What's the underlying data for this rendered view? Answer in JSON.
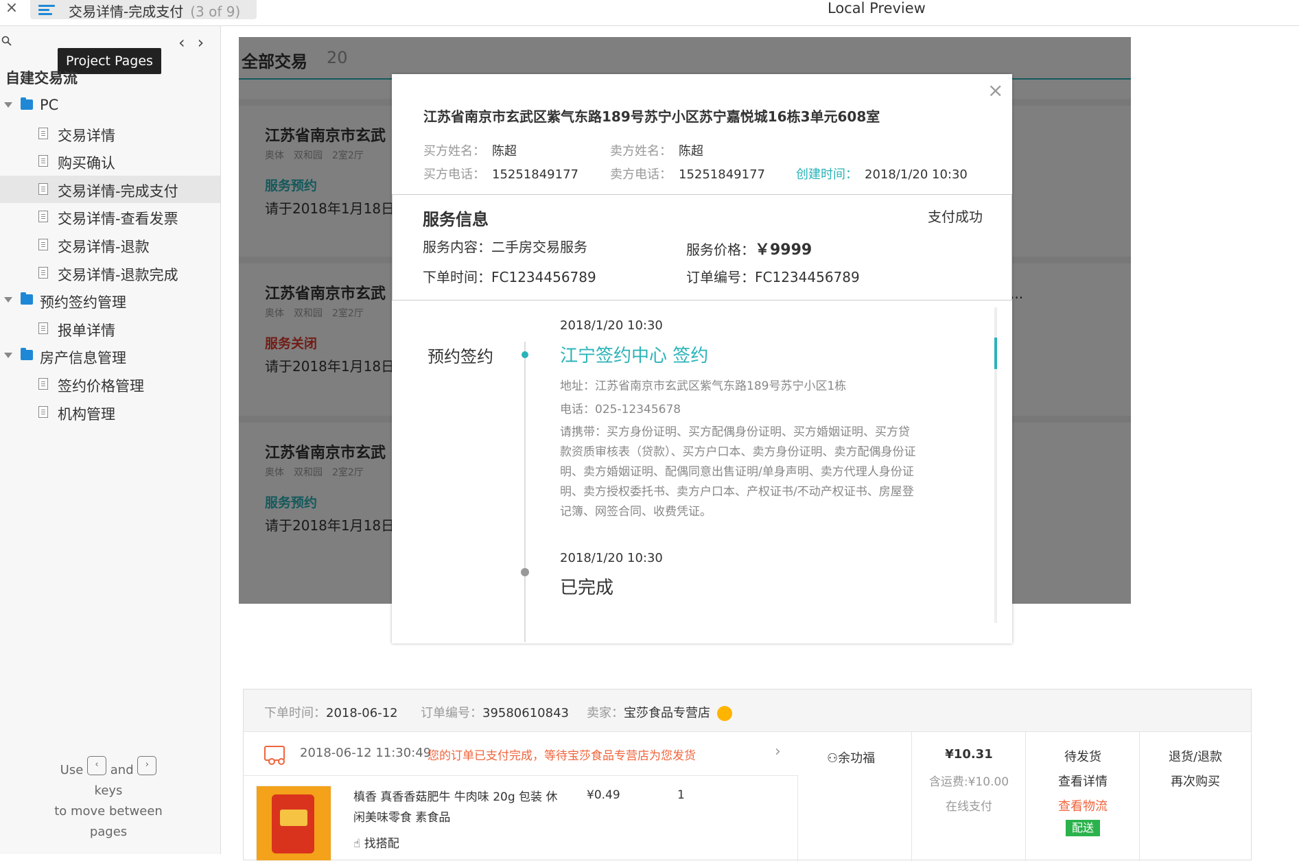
{
  "window": {
    "close_glyph": "×",
    "tab_title": "交易详情-完成支付",
    "tab_count": "(3 of 9)",
    "local_preview": "Local Preview"
  },
  "sidebar": {
    "tooltip": "Project Pages",
    "prev_glyph": "‹",
    "next_glyph": "›",
    "header": "自建交易流",
    "items": [
      {
        "label": "PC",
        "type": "folder",
        "level": 0
      },
      {
        "label": "交易详情",
        "type": "page",
        "level": 1
      },
      {
        "label": "购买确认",
        "type": "page",
        "level": 1
      },
      {
        "label": "交易详情-完成支付",
        "type": "page",
        "level": 1,
        "selected": true
      },
      {
        "label": "交易详情-查看发票",
        "type": "page",
        "level": 1
      },
      {
        "label": "交易详情-退款",
        "type": "page",
        "level": 1
      },
      {
        "label": "交易详情-退款完成",
        "type": "page",
        "level": 1
      },
      {
        "label": "预约签约管理",
        "type": "folder",
        "level": 0
      },
      {
        "label": "报单详情",
        "type": "page",
        "level": 1
      },
      {
        "label": "房产信息管理",
        "type": "folder",
        "level": 0
      },
      {
        "label": "签约价格管理",
        "type": "page",
        "level": 1
      },
      {
        "label": "机构管理",
        "type": "page",
        "level": 1
      }
    ],
    "help": {
      "use": "Use",
      "key_prev": "‹",
      "and": "and",
      "key_next": "›",
      "keys": "keys",
      "rest": "to move between",
      "pages": "pages"
    }
  },
  "list": {
    "title": "全部交易",
    "count": "20",
    "ellipsis": "...",
    "cards": [
      {
        "address": "江苏省南京市玄武",
        "sub1": "奥体",
        "sub2": "双和园",
        "sub3": "2室2厅",
        "status": "服务预约",
        "status_color": "#2ab3b8",
        "appt": "请于2018年1月18日"
      },
      {
        "address": "江苏省南京市玄武",
        "sub1": "奥体",
        "sub2": "双和园",
        "sub3": "2室2厅",
        "status": "服务关闭",
        "status_color": "#e23b2e",
        "appt": "请于2018年1月18日"
      },
      {
        "address": "江苏省南京市玄武",
        "sub1": "奥体",
        "sub2": "双和园",
        "sub3": "2室2厅",
        "status": "服务预约",
        "status_color": "#2ab3b8",
        "appt": "请于2018年1月18日"
      }
    ]
  },
  "modal": {
    "close": "×",
    "address": "江苏省南京市玄武区紫气东路189号苏宁小区苏宁嘉悦城16栋3单元608室",
    "buyer_name_label": "买方姓名：",
    "buyer_name": "陈超",
    "seller_name_label": "卖方姓名：",
    "seller_name": "陈超",
    "buyer_phone_label": "买方电话：",
    "buyer_phone": "15251849177",
    "seller_phone_label": "卖方电话：",
    "seller_phone": "15251849177",
    "created_label": "创建时间：",
    "created": "2018/1/20  10:30",
    "service": {
      "title": "服务信息",
      "status": "支付成功",
      "content_label": "服务内容：",
      "content": "二手房交易服务",
      "price_label": "服务价格：",
      "price": "￥9999",
      "order_time_label": "下单时间：",
      "order_time": "FC1234456789",
      "order_no_label": "订单编号：",
      "order_no": "FC1234456789"
    },
    "timeline": {
      "category": "预约签约",
      "entries": [
        {
          "time": "2018/1/20  10:30",
          "title": "江宁签约中心 签约",
          "address": "地址：江苏省南京市玄武区紫气东路189号苏宁小区1栋",
          "phone": "电话：025-12345678",
          "bring": "请携带：买方身份证明、买方配偶身份证明、买方婚姻证明、买方贷款资质审核表（贷款）、买方户口本、卖方身份证明、卖方配偶身份证明、卖方婚姻证明、配偶同意出售证明/单身声明、卖方代理人身份证明、卖方授权委托书、卖方户口本、产权证书/不动产权证书、房屋登记簿、网签合同、收费凭证。"
        },
        {
          "time": "2018/1/20  10:30",
          "title": "已完成"
        }
      ]
    }
  },
  "order": {
    "order_time_label": "下单时间：",
    "order_time": "2018-06-12",
    "order_no_label": "订单编号：",
    "order_no": "39580610843",
    "seller_label": "卖家：",
    "seller": "宝莎食品专营店",
    "notice_time": "2018-06-12 11:30:49",
    "notice_text": "您的订单已支付完成，等待宝莎食品专营店为您发货",
    "product_name": "槙香 真香香菇肥牛 牛肉味 20g 包装 休闲美味零食 素食品",
    "match": "找搭配",
    "unit_price": "¥0.49",
    "qty": "1",
    "buyer": "余功福",
    "total": "¥10.31",
    "shipping": "含运费:¥10.00",
    "pay_method": "在线支付",
    "state": "待发货",
    "detail_link": "查看详情",
    "logistics_link": "查看物流",
    "ship_tag": "配送",
    "refund": "退货/退款",
    "rebuy": "再次购买"
  }
}
